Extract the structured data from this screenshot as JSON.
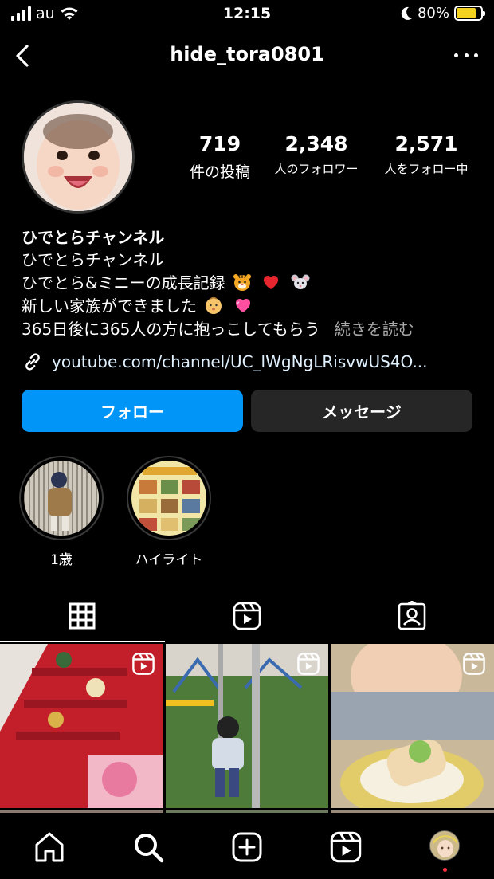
{
  "status": {
    "carrier": "au",
    "time": "12:15",
    "battery": "80%",
    "battery_level": 0.8,
    "icons": [
      "signal-icon",
      "wifi-icon",
      "moon-icon",
      "battery-charging-icon"
    ]
  },
  "header": {
    "username": "hide_tora0801",
    "icons": [
      "back-icon",
      "more-icon"
    ]
  },
  "profile": {
    "stats": [
      {
        "num": "719",
        "label": "件の投稿"
      },
      {
        "num": "2,348",
        "label": "人のフォロワー"
      },
      {
        "num": "2,571",
        "label": "人をフォロー中"
      }
    ],
    "display_name": "ひでとらチャンネル",
    "bio": {
      "line1": "ひでとらチャンネル",
      "line2": "ひでとら&ミニーの成長記録",
      "line2_emojis": [
        "tiger-face-icon",
        "red-heart-icon",
        "mouse-face-icon"
      ],
      "line3": "新しい家族ができました",
      "line3_emojis": [
        "baby-icon",
        "pink-heart-icon"
      ],
      "line4": "365日後に365人の方に抱っこしてもらう",
      "more": "続きを読む"
    },
    "link": "youtube.com/channel/UC_lWgNgLRisvwUS4O..."
  },
  "actions": {
    "follow": "フォロー",
    "message": "メッセージ",
    "colors": {
      "follow_bg": "#0095f6",
      "message_bg": "#262626"
    }
  },
  "highlights": [
    {
      "label": "1歳"
    },
    {
      "label": "ハイライト"
    }
  ],
  "tabs": [
    {
      "name": "grid-icon",
      "active": true
    },
    {
      "name": "reels-icon",
      "active": false
    },
    {
      "name": "tagged-icon",
      "active": false
    }
  ],
  "bottom_nav": [
    "home-icon",
    "search-icon",
    "create-icon",
    "reels-icon",
    "profile-avatar"
  ]
}
